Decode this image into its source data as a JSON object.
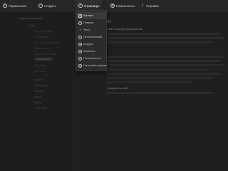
{
  "nav": {
    "items": [
      {
        "label": "Управление",
        "icon": "wrench-icon"
      },
      {
        "label": "Создать",
        "icon": "plus-icon"
      },
      {
        "label": "Страницы",
        "icon": "pages-icon"
      },
      {
        "label": "Компоненты",
        "icon": "components-icon"
      },
      {
        "label": "Справка",
        "icon": "help-icon"
      }
    ],
    "active_index": 2
  },
  "dropdown": {
    "items": [
      {
        "label": "Контент"
      },
      {
        "label": "Главная"
      },
      {
        "label": "Текст"
      },
      {
        "label": "Нестатический"
      },
      {
        "label": "Модули"
      },
      {
        "label": "Шаблоны"
      },
      {
        "label": "Пользователь"
      },
      {
        "label": "Настройки формы"
      }
    ]
  },
  "sidebar": {
    "items": [
      {
        "label": "Администрирование",
        "kind": "section"
      },
      {
        "label": "Обзор",
        "kind": "item"
      },
      {
        "label": "Настройки сайта",
        "kind": "child"
      },
      {
        "label": "Пользователи",
        "kind": "child"
      },
      {
        "label": "Группы пользователей",
        "kind": "child"
      },
      {
        "label": "Права доступа",
        "kind": "child"
      },
      {
        "label": "Администрирование",
        "kind": "child"
      },
      {
        "label": "Конфигурация",
        "kind": "active"
      },
      {
        "label": "Настройки",
        "kind": "child"
      },
      {
        "label": "Шаблоны",
        "kind": "child"
      },
      {
        "label": "Модули",
        "kind": "item"
      },
      {
        "label": "Компоненты",
        "kind": "item"
      },
      {
        "label": "Плагины",
        "kind": "item"
      },
      {
        "label": "Языки",
        "kind": "item"
      },
      {
        "label": "Медиа",
        "kind": "item"
      },
      {
        "label": "Статистика",
        "kind": "item"
      }
    ]
  },
  "content": {
    "title": "ет",
    "subtitle": "сайт в Центр управления",
    "heading": "Сохранить сайт"
  }
}
